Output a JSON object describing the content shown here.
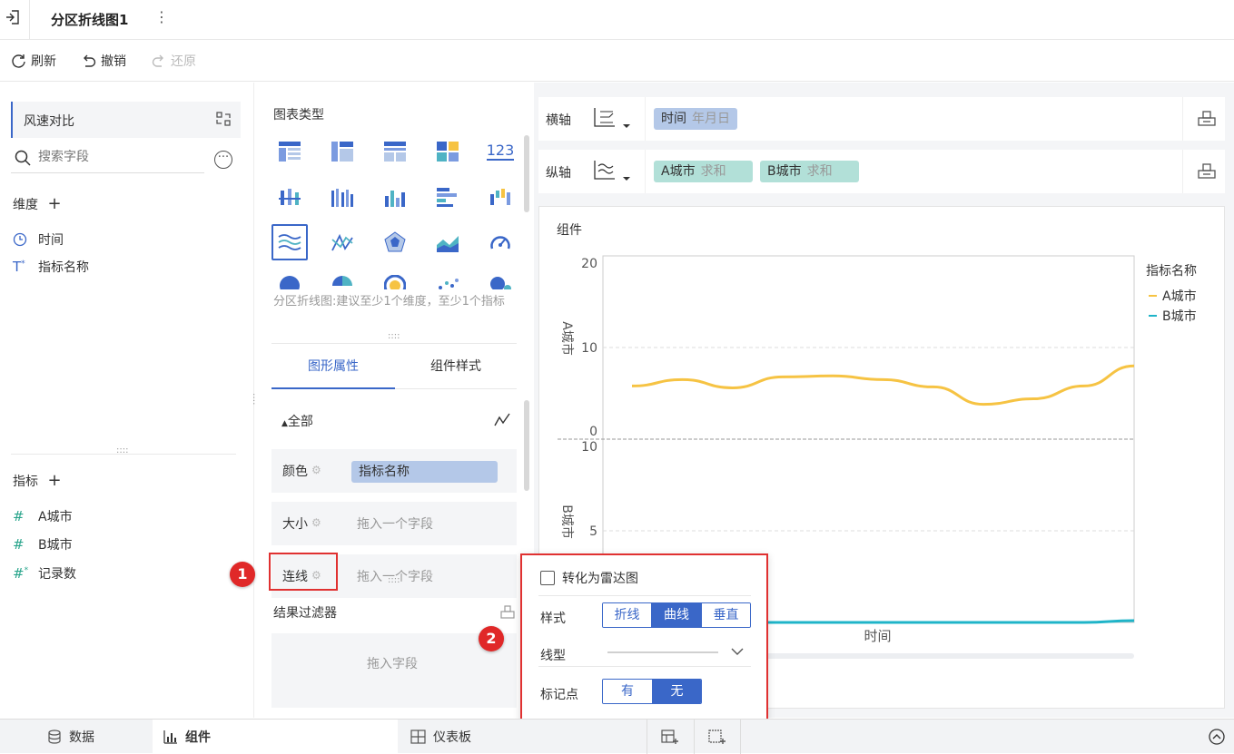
{
  "header": {
    "title": "分区折线图1"
  },
  "toolbar": {
    "refresh": "刷新",
    "undo": "撤销",
    "redo": "还原"
  },
  "left": {
    "dataset": "风速对比",
    "search_placeholder": "搜索字段",
    "dimensions_label": "维度",
    "dimensions": [
      "时间",
      "指标名称"
    ],
    "measures_label": "指标",
    "measures": [
      "A城市",
      "B城市",
      "记录数"
    ]
  },
  "middle": {
    "chart_type_label": "图表类型",
    "chart_hint": "分区折线图:建议至少1个维度，至少1个指标",
    "tabs": [
      "图形属性",
      "组件样式"
    ],
    "all_label": "全部",
    "props": {
      "color_label": "颜色",
      "color_value": "指标名称",
      "size_label": "大小",
      "size_placeholder": "拖入一个字段",
      "line_label": "连线",
      "line_placeholder": "拖入一个字段"
    },
    "filter_label": "结果过滤器",
    "filter_placeholder": "拖入字段"
  },
  "axes": {
    "x_label": "横轴",
    "x_field": {
      "name": "时间",
      "sub": "年月日"
    },
    "y_label": "纵轴",
    "y_fields": [
      {
        "name": "A城市",
        "sub": "求和"
      },
      {
        "name": "B城市",
        "sub": "求和"
      }
    ]
  },
  "chart_data": {
    "type": "line",
    "title": "组件",
    "xlabel": "时间",
    "legend_title": "指标名称",
    "legend_position": "right",
    "panels": [
      {
        "ylabel": "A城市",
        "ylim": [
          0,
          20
        ],
        "ticks": [
          0,
          10,
          20
        ]
      },
      {
        "ylabel": "B城市",
        "ylim": [
          0,
          10
        ],
        "ticks": [
          5,
          10
        ]
      }
    ],
    "series": [
      {
        "name": "A城市",
        "color": "#f6c343",
        "values": [
          5.8,
          6.5,
          5.6,
          6.8,
          6.9,
          6.5,
          5.7,
          3.8,
          4.4,
          5.8,
          8.0
        ]
      },
      {
        "name": "B城市",
        "color": "#1fb4c8",
        "values": [
          0.0,
          0.0,
          0.0,
          0.0,
          0.0,
          0.0,
          0.0,
          0.0,
          0.0,
          0.0,
          0.1
        ]
      }
    ]
  },
  "popup": {
    "radar_label": "转化为雷达图",
    "style_label": "样式",
    "style_options": [
      "折线",
      "曲线",
      "垂直"
    ],
    "style_selected": "曲线",
    "linetype_label": "线型",
    "marker_label": "标记点",
    "marker_options": [
      "有",
      "无"
    ],
    "marker_selected": "无"
  },
  "badges": [
    "1",
    "2"
  ],
  "bottom": {
    "tabs": [
      "数据",
      "组件",
      "仪表板"
    ]
  },
  "colors": {
    "accent": "#3a67c8",
    "highlight": "#e03131",
    "pill_blue": "#b4c8e8",
    "pill_teal": "#b2e0d8"
  }
}
